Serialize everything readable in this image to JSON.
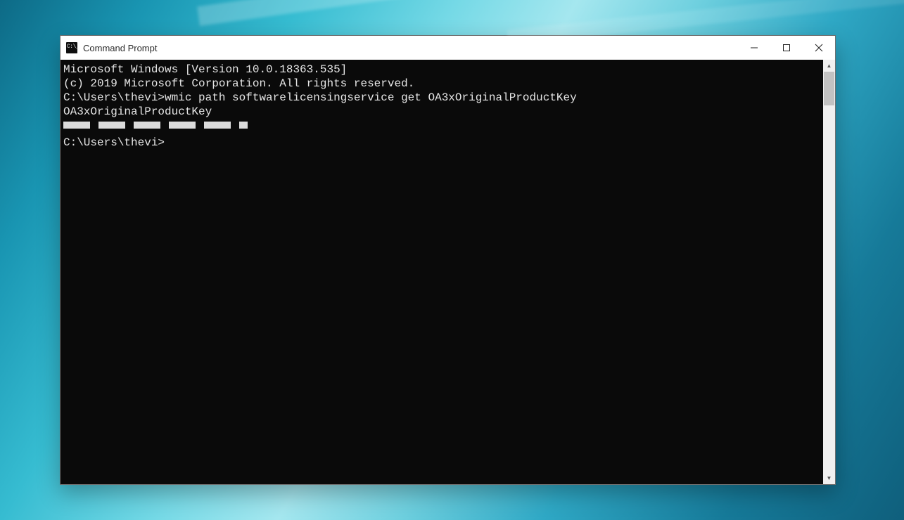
{
  "window": {
    "title": "Command Prompt",
    "icon": "cmd-icon"
  },
  "console": {
    "line1": "Microsoft Windows [Version 10.0.18363.535]",
    "line2": "(c) 2019 Microsoft Corporation. All rights reserved.",
    "blank1": "",
    "promptLine": "C:\\Users\\thevi>wmic path softwarelicensingservice get OA3xOriginalProductKey",
    "resultHeader": "OA3xOriginalProductKey",
    "redactedKeyWidthPx": 262,
    "blank2": "",
    "blank3": "",
    "prompt2": "C:\\Users\\thevi>"
  }
}
